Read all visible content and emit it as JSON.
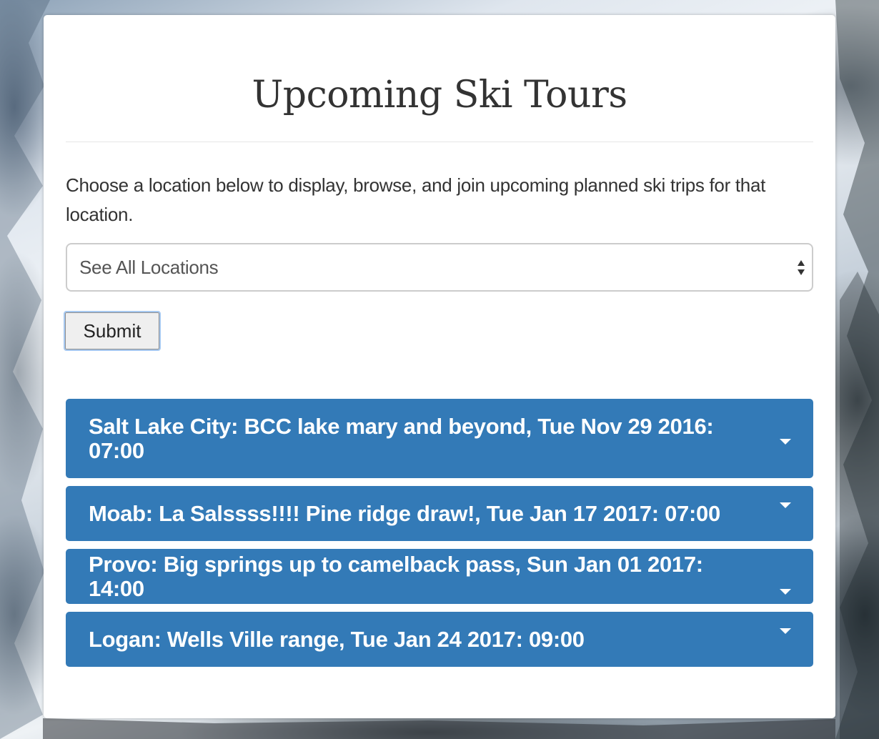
{
  "page": {
    "title": "Upcoming Ski Tours",
    "intro": "Choose a location below to display, browse, and join upcoming planned ski trips for that location."
  },
  "location_select": {
    "selected": "See All Locations"
  },
  "submit": {
    "label": "Submit"
  },
  "tours": [
    {
      "label": "Salt Lake City: BCC lake mary and beyond, Tue Nov 29 2016: 07:00",
      "icon": "caret-down-icon"
    },
    {
      "label": "Moab: La Salssss!!!! Pine ridge draw!, Tue Jan 17 2017: 07:00",
      "icon": "caret-down-icon"
    },
    {
      "label": "Provo: Big springs up to camelback pass, Sun Jan 01 2017: 14:00",
      "icon": "caret-down-icon"
    },
    {
      "label": "Logan: Wells Ville range, Tue Jan 24 2017: 09:00",
      "icon": "caret-down-icon"
    }
  ],
  "colors": {
    "tour_bar": "#337ab7",
    "text": "#333333",
    "card": "#ffffff"
  }
}
